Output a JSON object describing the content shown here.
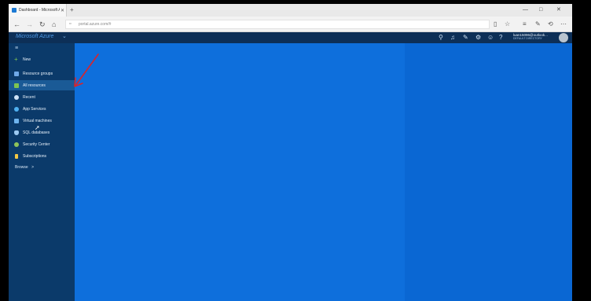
{
  "browser": {
    "tab_title": "Dashboard - Microsoft A",
    "close_glyph": "✕",
    "new_tab_glyph": "+",
    "url": "portal.azure.com/#",
    "window": {
      "minimize": "—",
      "maximize": "□",
      "close": "✕"
    }
  },
  "azure": {
    "brand": "Microsoft Azure",
    "user_name": "luan15096@outlook...",
    "user_directory": "DEFAULT DIRECTORY"
  },
  "sidebar": {
    "items": [
      {
        "label": "New",
        "icon": "plus-icon",
        "color": "#7ec451"
      },
      {
        "label": "Resource groups",
        "icon": "resource-groups-icon",
        "color": "#6fa9e8"
      },
      {
        "label": "All resources",
        "icon": "all-resources-icon",
        "color": "#7ec451"
      },
      {
        "label": "Recent",
        "icon": "clock-icon",
        "color": "#cfe3f7"
      },
      {
        "label": "App Services",
        "icon": "app-services-icon",
        "color": "#4fb0f0"
      },
      {
        "label": "Virtual machines",
        "icon": "virtual-machines-icon",
        "color": "#6fb4ee"
      },
      {
        "label": "SQL databases",
        "icon": "sql-databases-icon",
        "color": "#9cc9f2"
      },
      {
        "label": "Security Center",
        "icon": "security-center-icon",
        "color": "#8fc45a"
      },
      {
        "label": "Subscriptions",
        "icon": "subscriptions-icon",
        "color": "#f2c744"
      }
    ],
    "browse_label": "Browse",
    "browse_chevron": ">"
  },
  "colors": {
    "main_bg": "#0e6fdc",
    "sidebar_bg": "#0b3a6a",
    "annotation_arrow": "#d9242b"
  }
}
